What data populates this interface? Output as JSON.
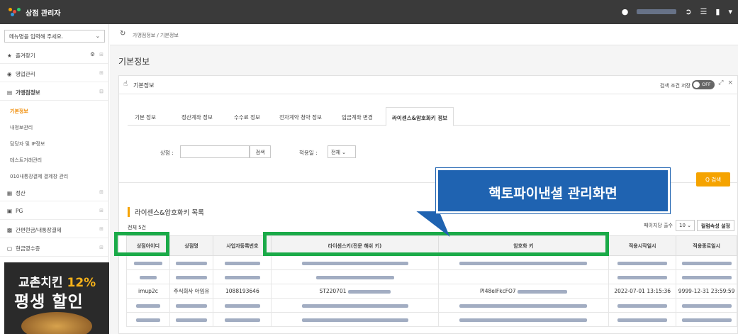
{
  "app": {
    "title": "상점 관리자"
  },
  "sidebar": {
    "menu_search_placeholder": "메뉴명을 입력해 주세요.",
    "items": [
      {
        "label": "즐겨찾기",
        "icon": "star-icon"
      },
      {
        "label": "영업관리",
        "icon": "eye-icon"
      },
      {
        "label": "가맹점정보",
        "icon": "document-icon"
      },
      {
        "label": "정산",
        "icon": "calculator-icon"
      },
      {
        "label": "PG",
        "icon": "card-icon"
      },
      {
        "label": "간편현금/내통장결제",
        "icon": "cash-icon"
      },
      {
        "label": "현금영수증",
        "icon": "receipt-icon"
      }
    ],
    "subitems": [
      {
        "label": "기본정보",
        "active": true
      },
      {
        "label": "내정보관리"
      },
      {
        "label": "담당자 및 IP정보"
      },
      {
        "label": "테스트거래관리"
      },
      {
        "label": "010내통장결제 결제창 관리"
      }
    ],
    "ad": {
      "line1_prefix": "교촌치킨",
      "line1_highlight": "12%",
      "line2": "평생 할인"
    }
  },
  "breadcrumb": {
    "path": "가맹점정보 / 기본정보"
  },
  "page": {
    "title": "기본정보"
  },
  "card": {
    "title": "기본정보",
    "save_condition_label": "검색 조건 저장",
    "toggle_label": "OFF"
  },
  "tabs": [
    {
      "label": "기본 정보"
    },
    {
      "label": "정산계좌 정보"
    },
    {
      "label": "수수료 정보"
    },
    {
      "label": "전자계약 청약 정보"
    },
    {
      "label": "입금계좌 변경"
    },
    {
      "label": "라이센스&암호화키 정보",
      "active": true
    }
  ],
  "search": {
    "shop_label": "상점 :",
    "search_button": "검색",
    "apply_date_label": "적용일 :",
    "apply_date_value": "전체",
    "main_search_button": "Q 검색"
  },
  "list": {
    "title": "라이센스&암호화키 목록",
    "total": "전체 5건",
    "per_page_label": "페이지당 출수",
    "per_page_value": "10",
    "column_settings": "컬럼속성 설정",
    "columns": [
      "상점아이디",
      "상점명",
      "사업자등록번호",
      "라이센스키(전문 해쉬 키)",
      "암호화 키",
      "적용시작일시",
      "적용종료일시"
    ],
    "visible_row": {
      "shop_id": "imup2c",
      "shop_name": "주식회사 아임유",
      "biz_no": "1088193646",
      "license_prefix": "ST220701",
      "crypto_prefix": "PI48elFkcFO7",
      "start": "2022-07-01 13:15:36",
      "end": "9999-12-31 23:59:59"
    }
  },
  "callout": {
    "text": "핵토파이낸셜 관리화면"
  },
  "colors": {
    "accent": "#f5a300",
    "highlight": "#1aaa48",
    "callout": "#1f63b1"
  }
}
